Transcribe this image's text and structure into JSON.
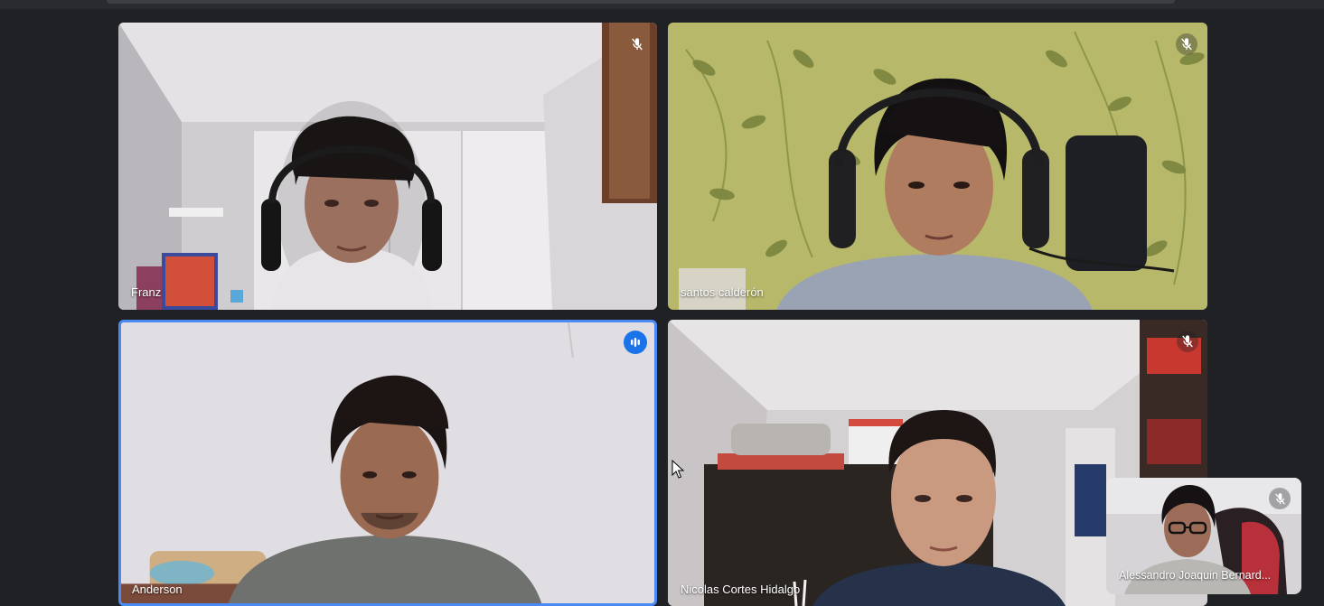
{
  "meeting": {
    "participants": [
      {
        "name": "Franz",
        "mic_muted": true,
        "speaking": false
      },
      {
        "name": "santos calderón",
        "mic_muted": true,
        "speaking": false
      },
      {
        "name": "Anderson",
        "mic_muted": false,
        "speaking": true
      },
      {
        "name": "Nicolas Cortes Hidalgo",
        "mic_muted": true,
        "speaking": false
      }
    ],
    "self_view": {
      "name": "Alessandro Joaquin Bernard...",
      "mic_muted": true
    }
  },
  "icons": {
    "mic_off": "mic-off-icon",
    "speaking": "audio-level-icon",
    "cursor": "mouse-pointer-icon"
  },
  "colors": {
    "background": "#202124",
    "speaking_border": "#4a8af4",
    "speaking_badge": "#1a73e8"
  }
}
